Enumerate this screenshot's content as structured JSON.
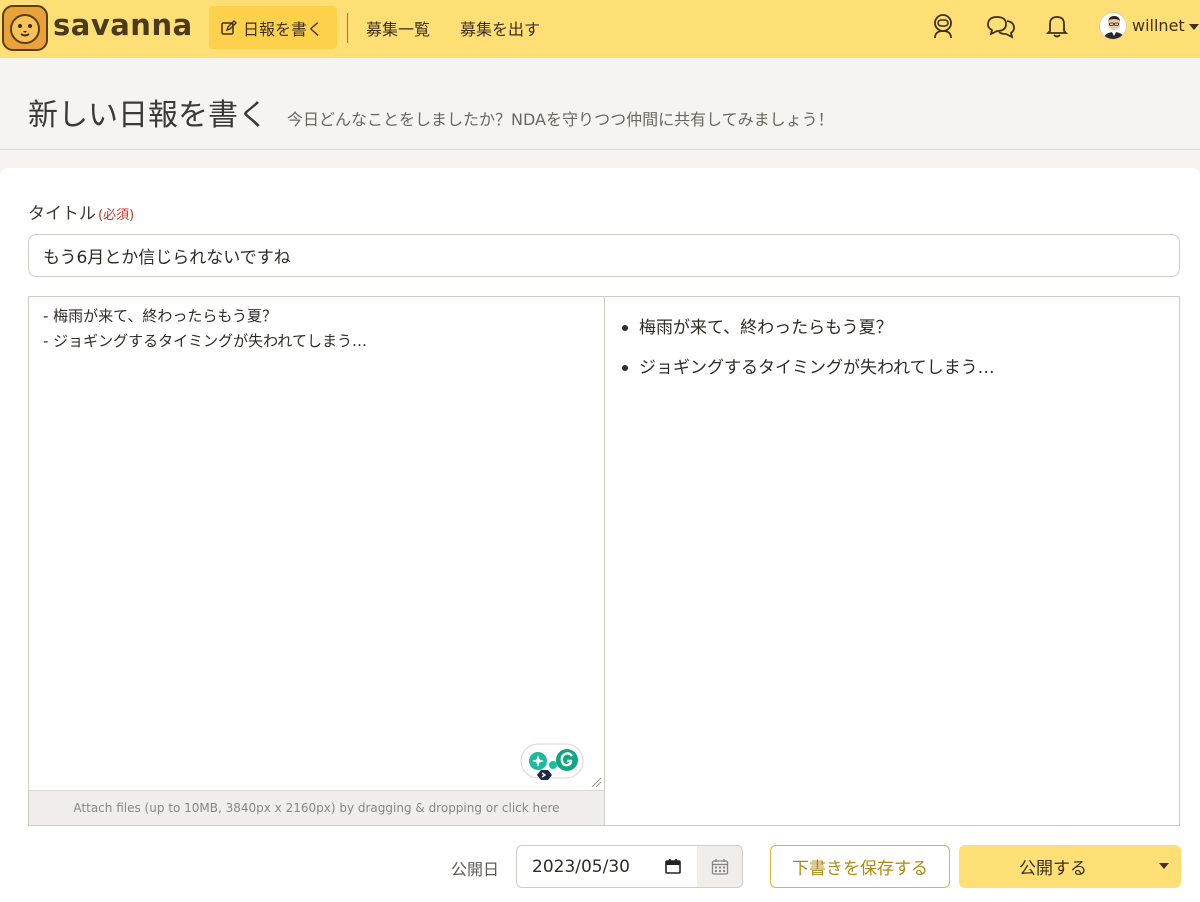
{
  "app": {
    "name": "savanna",
    "logo_icon": "lion-icon"
  },
  "header": {
    "nav": [
      {
        "label": "日報を書く",
        "icon": "edit-icon",
        "active": true
      },
      {
        "label": "募集一覧"
      },
      {
        "label": "募集を出す"
      }
    ],
    "icons": [
      "astronaut-icon",
      "chat-icon",
      "bell-icon"
    ],
    "user": {
      "name": "willnet",
      "avatar": "avatar"
    }
  },
  "page": {
    "title": "新しい日報を書く",
    "subtitle": "今日どんなことをしましたか？NDAを守りつつ仲間に共有してみましょう！"
  },
  "form": {
    "title_label": "タイトル",
    "required_label": "(必須)",
    "title_value": "もう6月とか信じられないですね",
    "body_value": "- 梅雨が来て、終わったらもう夏？\n- ジョギングするタイミングが失われてしまう…",
    "attach_hint": "Attach files (up to 10MB, 3840px x 2160px) by dragging & dropping or click here",
    "preview_items": [
      "梅雨が来て、終わったらもう夏？",
      "ジョギングするタイミングが失われてしまう…"
    ],
    "publish_date_label": "公開日",
    "publish_date_value": "2023/05/30",
    "save_draft_label": "下書きを保存する",
    "publish_label": "公開する"
  },
  "colors": {
    "header_bg": "#fddf75",
    "active_nav_bg": "#fdd14b",
    "draft_border": "#d9b53c",
    "required_text": "#c0392b"
  }
}
